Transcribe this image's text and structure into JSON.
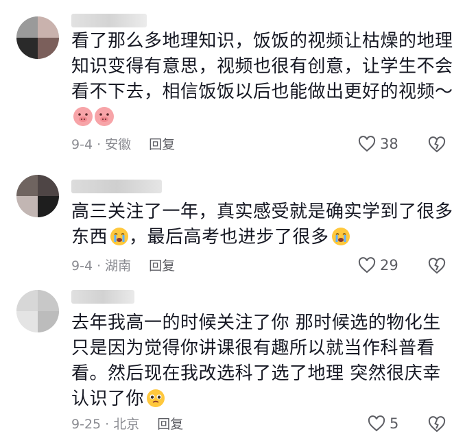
{
  "comments": [
    {
      "text": "看了那么多地理知识，饭饭的视频让枯燥的地理知识变得有意思，视频也很有创意，让学生不会看不下去，相信饭饭以后也能做出更好的视频～",
      "emojis": [
        "pig-face",
        "pig-face"
      ],
      "date_location": "9-4 · 安徽",
      "reply_label": "回复",
      "likes": "38"
    },
    {
      "text": "高三关注了一年，真实感受就是确实学到了很多东西",
      "text_after_emoji": "，最后高考也进步了很多",
      "emojis": [
        "crying-face",
        "crying-face"
      ],
      "date_location": "9-4 · 湖南",
      "reply_label": "回复",
      "likes": "29"
    },
    {
      "text": "去年我高一的时候关注了你 那时候选的物化生只是因为觉得你讲课很有趣所以就当作科普看看。然后现在我改选科了选了地理 突然很庆幸认识了你",
      "emojis": [
        "pleading-face"
      ],
      "date_location": "9-25 · 北京",
      "reply_label": "回复",
      "likes": "5"
    }
  ],
  "colors": {
    "text": "#161823",
    "meta": "#8a8b91",
    "reply": "#5c5d63",
    "pig_emoji": "#f7a4a8",
    "cry_emoji": "#ffc83d"
  },
  "icons": [
    "heart-outline-icon",
    "broken-heart-icon"
  ]
}
